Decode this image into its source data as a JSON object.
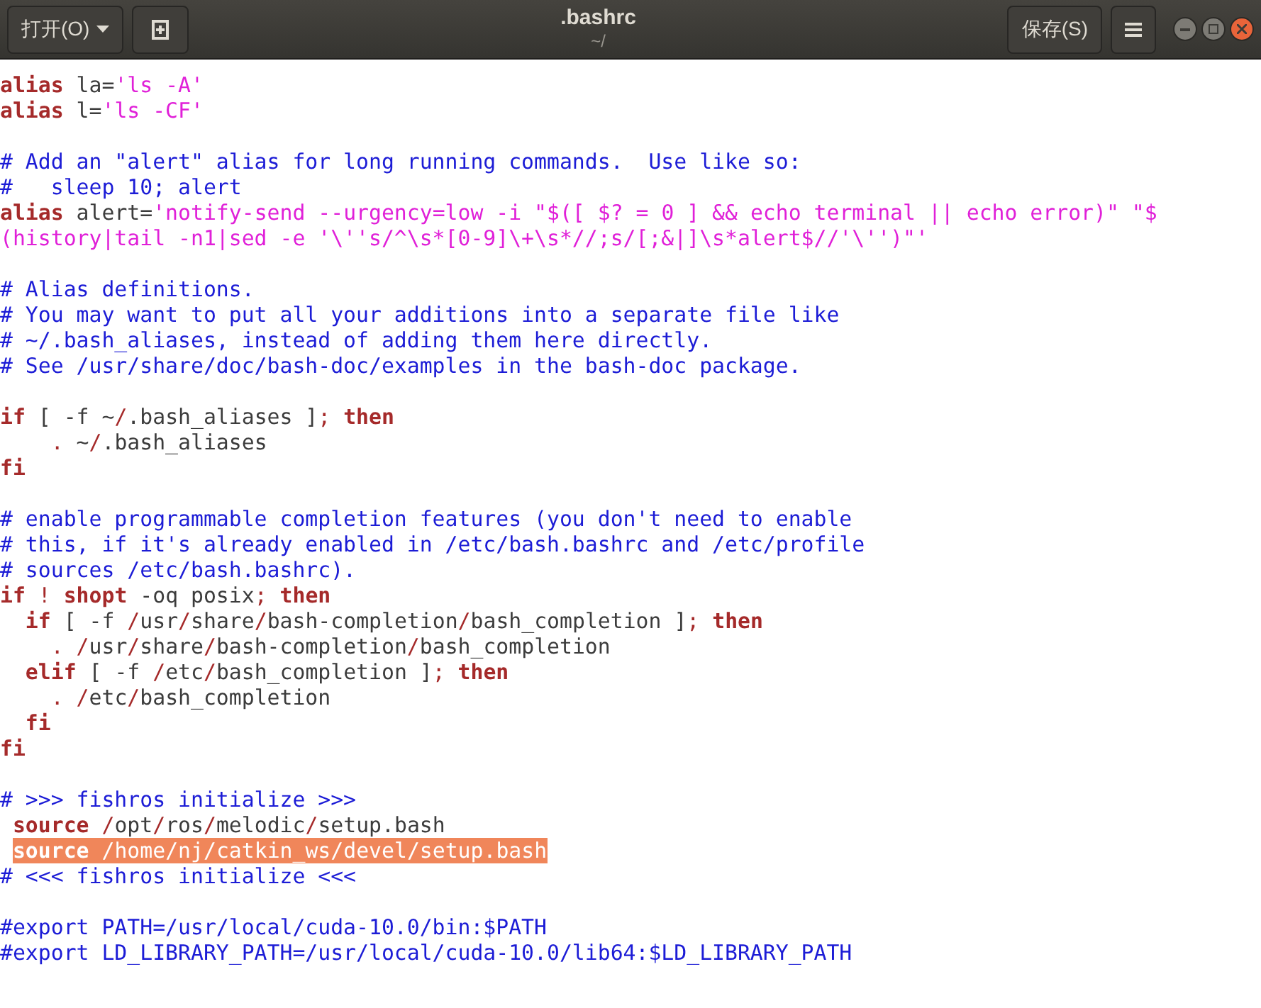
{
  "header": {
    "open_button": {
      "label": "打开(O)"
    },
    "title": ".bashrc",
    "subtitle": "~/",
    "save_button": {
      "label": "保存(S)"
    }
  },
  "lines": [
    {
      "kind": "code",
      "segments": [
        {
          "kind": "keyword",
          "text": "alias"
        },
        {
          "kind": "plain",
          "text": " la="
        },
        {
          "kind": "string",
          "text": "'ls -A'"
        }
      ]
    },
    {
      "kind": "code",
      "segments": [
        {
          "kind": "keyword",
          "text": "alias"
        },
        {
          "kind": "plain",
          "text": " l="
        },
        {
          "kind": "string",
          "text": "'ls -CF'"
        }
      ]
    },
    {
      "kind": "blank"
    },
    {
      "kind": "code",
      "segments": [
        {
          "kind": "comment",
          "text": "# Add an \"alert\" alias for long running commands.  Use like so:"
        }
      ]
    },
    {
      "kind": "code",
      "segments": [
        {
          "kind": "comment",
          "text": "#   sleep 10; alert"
        }
      ]
    },
    {
      "kind": "code",
      "segments": [
        {
          "kind": "keyword",
          "text": "alias"
        },
        {
          "kind": "plain",
          "text": " alert="
        },
        {
          "kind": "string",
          "text": "'notify-send --urgency=low -i \"$([ $? = 0 ] && echo terminal || echo error)\" \"$"
        }
      ]
    },
    {
      "kind": "code",
      "segments": [
        {
          "kind": "string",
          "text": "(history|tail -n1|sed -e '\\''s/^\\s*[0-9]\\+\\s*//;s/[;&|]\\s*alert$//'\\'')\"'"
        }
      ]
    },
    {
      "kind": "blank"
    },
    {
      "kind": "code",
      "segments": [
        {
          "kind": "comment",
          "text": "# Alias definitions."
        }
      ]
    },
    {
      "kind": "code",
      "segments": [
        {
          "kind": "comment",
          "text": "# You may want to put all your additions into a separate file like"
        }
      ]
    },
    {
      "kind": "code",
      "segments": [
        {
          "kind": "comment",
          "text": "# ~/.bash_aliases, instead of adding them here directly."
        }
      ]
    },
    {
      "kind": "code",
      "segments": [
        {
          "kind": "comment",
          "text": "# See /usr/share/doc/bash-doc/examples in the bash-doc package."
        }
      ]
    },
    {
      "kind": "blank"
    },
    {
      "kind": "code",
      "segments": [
        {
          "kind": "keyword",
          "text": "if"
        },
        {
          "kind": "plain",
          "text": " [ -f ~"
        },
        {
          "kind": "operator",
          "text": "/"
        },
        {
          "kind": "plain",
          "text": ".bash_aliases ]"
        },
        {
          "kind": "operator",
          "text": ";"
        },
        {
          "kind": "keyword",
          "text": " then"
        }
      ]
    },
    {
      "kind": "code",
      "segments": [
        {
          "kind": "operator",
          "text": "    ."
        },
        {
          "kind": "plain",
          "text": " ~"
        },
        {
          "kind": "operator",
          "text": "/"
        },
        {
          "kind": "plain",
          "text": ".bash_aliases"
        }
      ]
    },
    {
      "kind": "code",
      "segments": [
        {
          "kind": "keyword",
          "text": "fi"
        }
      ]
    },
    {
      "kind": "blank"
    },
    {
      "kind": "code",
      "segments": [
        {
          "kind": "comment",
          "text": "# enable programmable completion features (you don't need to enable"
        }
      ]
    },
    {
      "kind": "code",
      "segments": [
        {
          "kind": "comment",
          "text": "# this, if it's already enabled in /etc/bash.bashrc and /etc/profile"
        }
      ]
    },
    {
      "kind": "code",
      "segments": [
        {
          "kind": "comment",
          "text": "# sources /etc/bash.bashrc)."
        }
      ]
    },
    {
      "kind": "code",
      "segments": [
        {
          "kind": "keyword",
          "text": "if"
        },
        {
          "kind": "operator",
          "text": " !"
        },
        {
          "kind": "keyword",
          "text": " shopt"
        },
        {
          "kind": "plain",
          "text": " -oq posix"
        },
        {
          "kind": "operator",
          "text": ";"
        },
        {
          "kind": "keyword",
          "text": " then"
        }
      ]
    },
    {
      "kind": "code",
      "segments": [
        {
          "kind": "keyword",
          "text": "  if"
        },
        {
          "kind": "plain",
          "text": " [ -f "
        },
        {
          "kind": "operator",
          "text": "/"
        },
        {
          "kind": "plain",
          "text": "usr"
        },
        {
          "kind": "operator",
          "text": "/"
        },
        {
          "kind": "plain",
          "text": "share"
        },
        {
          "kind": "operator",
          "text": "/"
        },
        {
          "kind": "plain",
          "text": "bash-completion"
        },
        {
          "kind": "operator",
          "text": "/"
        },
        {
          "kind": "plain",
          "text": "bash_completion ]"
        },
        {
          "kind": "operator",
          "text": ";"
        },
        {
          "kind": "keyword",
          "text": " then"
        }
      ]
    },
    {
      "kind": "code",
      "segments": [
        {
          "kind": "operator",
          "text": "    ."
        },
        {
          "kind": "operator",
          "text": " /"
        },
        {
          "kind": "plain",
          "text": "usr"
        },
        {
          "kind": "operator",
          "text": "/"
        },
        {
          "kind": "plain",
          "text": "share"
        },
        {
          "kind": "operator",
          "text": "/"
        },
        {
          "kind": "plain",
          "text": "bash-completion"
        },
        {
          "kind": "operator",
          "text": "/"
        },
        {
          "kind": "plain",
          "text": "bash_completion"
        }
      ]
    },
    {
      "kind": "code",
      "segments": [
        {
          "kind": "keyword",
          "text": "  elif"
        },
        {
          "kind": "plain",
          "text": " [ -f "
        },
        {
          "kind": "operator",
          "text": "/"
        },
        {
          "kind": "plain",
          "text": "etc"
        },
        {
          "kind": "operator",
          "text": "/"
        },
        {
          "kind": "plain",
          "text": "bash_completion ]"
        },
        {
          "kind": "operator",
          "text": ";"
        },
        {
          "kind": "keyword",
          "text": " then"
        }
      ]
    },
    {
      "kind": "code",
      "segments": [
        {
          "kind": "operator",
          "text": "    ."
        },
        {
          "kind": "operator",
          "text": " /"
        },
        {
          "kind": "plain",
          "text": "etc"
        },
        {
          "kind": "operator",
          "text": "/"
        },
        {
          "kind": "plain",
          "text": "bash_completion"
        }
      ]
    },
    {
      "kind": "code",
      "segments": [
        {
          "kind": "keyword",
          "text": "  fi"
        }
      ]
    },
    {
      "kind": "code",
      "segments": [
        {
          "kind": "keyword",
          "text": "fi"
        }
      ]
    },
    {
      "kind": "blank"
    },
    {
      "kind": "code",
      "segments": [
        {
          "kind": "comment",
          "text": "# >>> fishros initialize >>>"
        }
      ]
    },
    {
      "kind": "code",
      "segments": [
        {
          "kind": "keyword",
          "text": " source"
        },
        {
          "kind": "operator",
          "text": " /"
        },
        {
          "kind": "plain",
          "text": "opt"
        },
        {
          "kind": "operator",
          "text": "/"
        },
        {
          "kind": "plain",
          "text": "ros"
        },
        {
          "kind": "operator",
          "text": "/"
        },
        {
          "kind": "plain",
          "text": "melodic"
        },
        {
          "kind": "operator",
          "text": "/"
        },
        {
          "kind": "plain",
          "text": "setup.bash"
        }
      ]
    },
    {
      "kind": "selection",
      "segments": [
        {
          "kind": "keyword",
          "text": " source"
        },
        {
          "kind": "operator",
          "text": " /"
        },
        {
          "kind": "plain",
          "text": "home"
        },
        {
          "kind": "operator",
          "text": "/"
        },
        {
          "kind": "plain",
          "text": "nj"
        },
        {
          "kind": "operator",
          "text": "/"
        },
        {
          "kind": "plain",
          "text": "catkin_ws"
        },
        {
          "kind": "operator",
          "text": "/"
        },
        {
          "kind": "plain",
          "text": "devel"
        },
        {
          "kind": "operator",
          "text": "/"
        },
        {
          "kind": "plain",
          "text": "setup.bash"
        }
      ]
    },
    {
      "kind": "code",
      "segments": [
        {
          "kind": "comment",
          "text": "# <<< fishros initialize <<<"
        }
      ]
    },
    {
      "kind": "blank"
    },
    {
      "kind": "code",
      "segments": [
        {
          "kind": "comment",
          "text": "#export PATH=/usr/local/cuda-10.0/bin:$PATH"
        }
      ]
    },
    {
      "kind": "code",
      "segments": [
        {
          "kind": "comment",
          "text": "#export LD_LIBRARY_PATH=/usr/local/cuda-10.0/lib64:$LD_LIBRARY_PATH"
        }
      ]
    }
  ]
}
